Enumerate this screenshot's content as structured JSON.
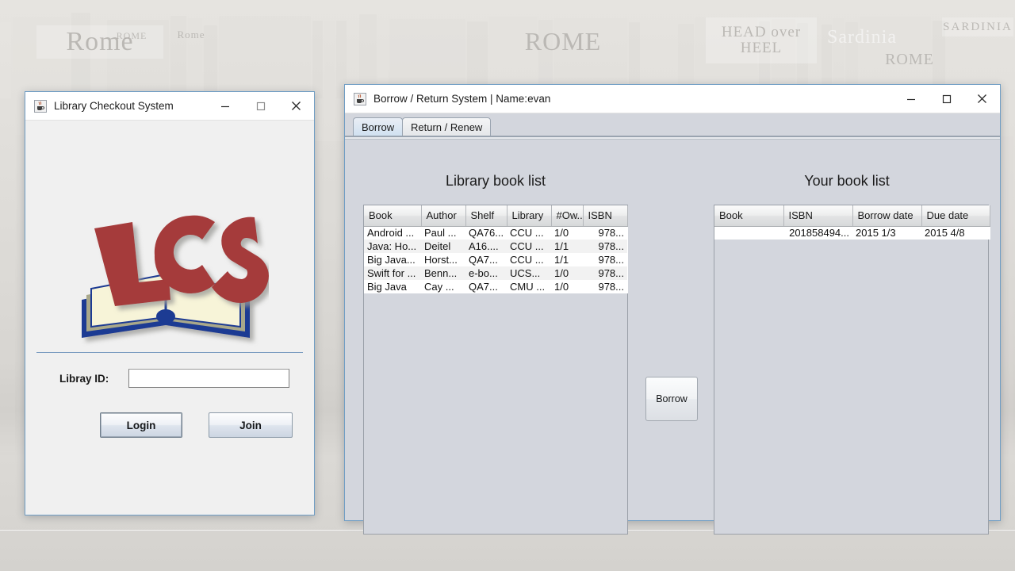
{
  "desktop": {
    "wallpaper_description": "blurred washed-out bookshelf of travel guide books",
    "posters": [
      {
        "text": "Rome"
      },
      {
        "text": "Rome"
      },
      {
        "text": "ROME"
      },
      {
        "text": "ROME"
      },
      {
        "text": "ROME"
      },
      {
        "text": "HEAD over HEEL"
      },
      {
        "text": "Sardinia"
      },
      {
        "text": "SARDINIA"
      }
    ]
  },
  "login_window": {
    "title": "Library Checkout System",
    "icon": "java-coffee-cup-icon",
    "controls": {
      "minimize": "minimize-icon",
      "maximize": "maximize-icon",
      "close": "close-icon"
    },
    "logo": {
      "text": "LCS",
      "description": "open book with LCS letters",
      "letter_color": "#a53a3a",
      "book_cover_color": "#1f3a93",
      "page_color": "#f7f4d8"
    },
    "id_label": "Libray ID:",
    "id_value": "",
    "id_placeholder": "",
    "login_button": "Login",
    "join_button": "Join"
  },
  "main_window": {
    "title": "Borrow / Return System | Name:evan",
    "icon": "java-coffee-cup-icon",
    "controls": {
      "minimize": "minimize-icon",
      "maximize": "maximize-icon",
      "close": "close-icon"
    },
    "tabs": [
      {
        "label": "Borrow",
        "selected": true
      },
      {
        "label": "Return / Renew",
        "selected": false
      }
    ],
    "library_panel": {
      "title": "Library book list",
      "columns": [
        "Book",
        "Author",
        "Shelf",
        "Library",
        "#Ow...",
        "ISBN"
      ],
      "rows": [
        {
          "book": "Android ...",
          "author": "Paul ...",
          "shelf": "QA76...",
          "library": "CCU ...",
          "owned": "1/0",
          "isbn": "978..."
        },
        {
          "book": "Java: Ho...",
          "author": "Deitel",
          "shelf": "A16....",
          "library": "CCU ...",
          "owned": "1/1",
          "isbn": "978..."
        },
        {
          "book": "Big Java...",
          "author": "Horst...",
          "shelf": "QA7...",
          "library": "CCU ...",
          "owned": "1/1",
          "isbn": "978..."
        },
        {
          "book": "Swift for ...",
          "author": "Benn...",
          "shelf": "e-bo...",
          "library": "UCS...",
          "owned": "1/0",
          "isbn": "978..."
        },
        {
          "book": "Big Java",
          "author": "Cay ...",
          "shelf": "QA7...",
          "library": "CMU ...",
          "owned": "1/0",
          "isbn": "978..."
        }
      ]
    },
    "borrow_button": "Borrow",
    "user_panel": {
      "title": "Your book list",
      "columns": [
        "Book",
        "ISBN",
        "Borrow date",
        "Due date"
      ],
      "rows": [
        {
          "book": "",
          "isbn": "201858494...",
          "borrow_date": "2015 1/3",
          "due_date": "2015 4/8"
        }
      ]
    }
  }
}
